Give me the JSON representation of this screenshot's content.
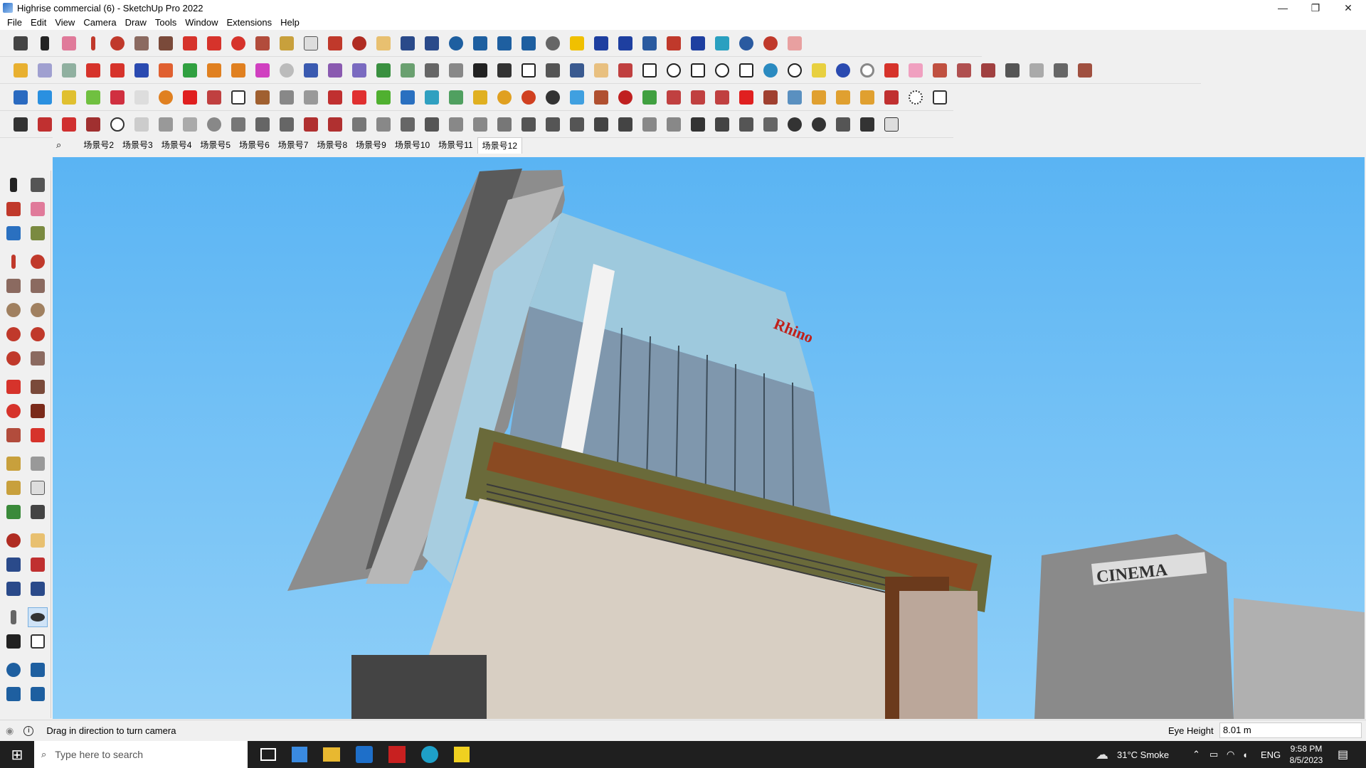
{
  "window": {
    "title": "Highrise commercial (6) - SketchUp Pro 2022",
    "controls": [
      "—",
      "❐",
      "✕"
    ]
  },
  "menu": [
    "File",
    "Edit",
    "View",
    "Camera",
    "Draw",
    "Tools",
    "Window",
    "Extensions",
    "Help"
  ],
  "scenes": {
    "tabs": [
      "场景号2",
      "场景号3",
      "场景号4",
      "场景号5",
      "场景号6",
      "场景号7",
      "场景号8",
      "场景号9",
      "场景号10",
      "场景号11",
      "场景号12"
    ],
    "active": "场景号12"
  },
  "model": {
    "sign_top": "Rhino",
    "sign_cinema": "CINEMA"
  },
  "status": {
    "hint": "Drag in direction to turn camera",
    "measure_label": "Eye Height",
    "measure_value": "8.01 m"
  },
  "taskbar": {
    "search_placeholder": "Type here to search",
    "weather": "31°C  Smoke",
    "language": "ENG",
    "time": "9:58 PM",
    "date": "8/5/2023"
  },
  "colors": {
    "sky": "#6cc0f6",
    "taskbar": "#1f1f1f",
    "accent_red": "#d6332b"
  }
}
